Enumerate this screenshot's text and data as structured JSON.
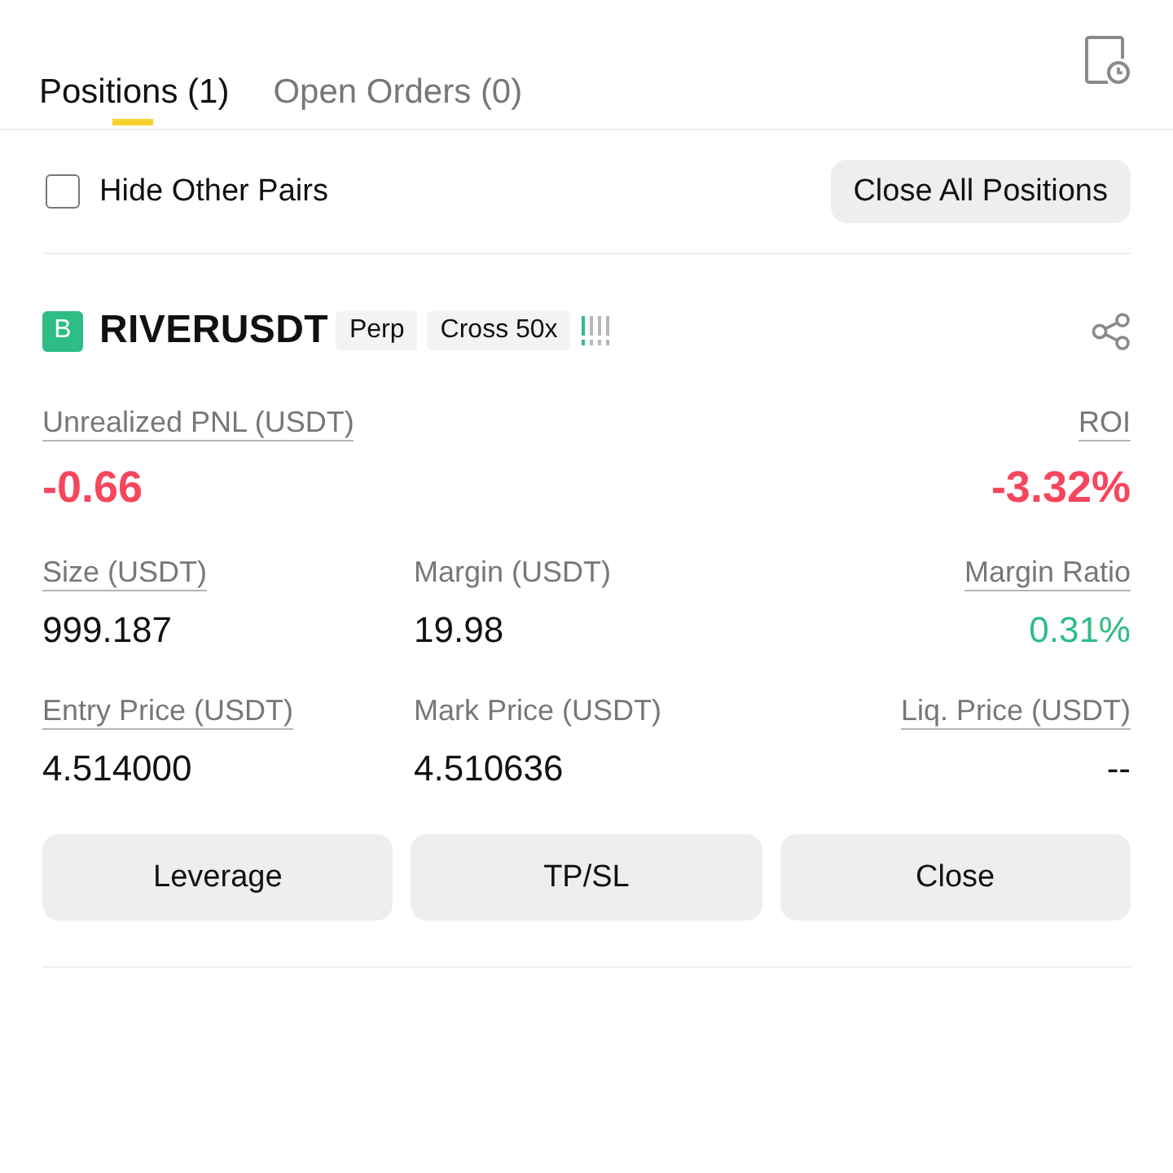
{
  "tabs": [
    {
      "label": "Positions (1)",
      "selected": true
    },
    {
      "label": "Open Orders (0)",
      "selected": false
    }
  ],
  "filter": {
    "label": "Hide Other Pairs",
    "checked": false
  },
  "close_all_button": "Close All Positions",
  "position": {
    "side_badge": "B",
    "symbol": "RIVERUSDT",
    "tags": [
      "Perp",
      "Cross 50x"
    ],
    "pnl": {
      "label": "Unrealized PNL (USDT)",
      "value": "-0.66",
      "underlined": true
    },
    "roi": {
      "label": "ROI",
      "value": "-3.32%",
      "underlined": true
    },
    "fields": [
      {
        "label": "Size (USDT)",
        "value": "999.187",
        "underlined": true,
        "color": "#111111"
      },
      {
        "label": "Margin (USDT)",
        "value": "19.98",
        "underlined": false,
        "color": "#111111"
      },
      {
        "label": "Margin Ratio",
        "value": "0.31%",
        "underlined": true,
        "color": "#2ebd85"
      },
      {
        "label": "Entry Price (USDT)",
        "value": "4.514000",
        "underlined": true,
        "color": "#111111"
      },
      {
        "label": "Mark Price (USDT)",
        "value": "4.510636",
        "underlined": false,
        "color": "#111111"
      },
      {
        "label": "Liq. Price (USDT)",
        "value": "--",
        "underlined": true,
        "color": "#111111"
      }
    ],
    "actions": [
      "Leverage",
      "TP/SL",
      "Close"
    ]
  }
}
